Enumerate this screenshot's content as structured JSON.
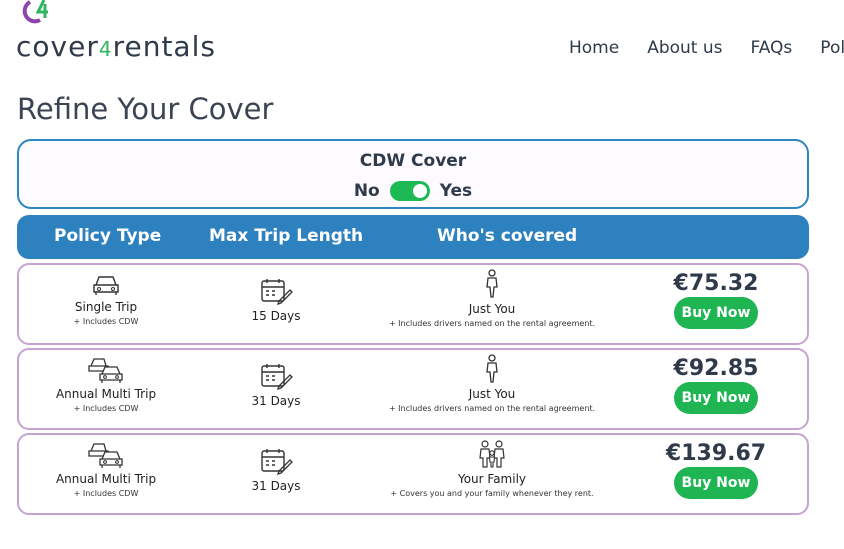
{
  "logo": {
    "part1": "cover",
    "part2": "4",
    "part3": "rentals"
  },
  "nav": [
    {
      "label": "Home"
    },
    {
      "label": "About us"
    },
    {
      "label": "FAQs"
    },
    {
      "label": "Pol"
    }
  ],
  "page_title": "Refine Your Cover",
  "cdw": {
    "title": "CDW Cover",
    "no_label": "No",
    "yes_label": "Yes",
    "enabled": true
  },
  "table_header": {
    "policy_type": "Policy Type",
    "max_trip": "Max Trip Length",
    "who": "Who's covered"
  },
  "rows": [
    {
      "policy": "Single Trip",
      "policy_sub": "+ Includes CDW",
      "trip": "15 Days",
      "who": "Just You",
      "who_sub": "+ Includes drivers named on the rental agreement.",
      "price": "€75.32",
      "buy": "Buy Now"
    },
    {
      "policy": "Annual Multi Trip",
      "policy_sub": "+ Includes CDW",
      "trip": "31 Days",
      "who": "Just You",
      "who_sub": "+ Includes drivers named on the rental agreement.",
      "price": "€92.85",
      "buy": "Buy Now"
    },
    {
      "policy": "Annual Multi Trip",
      "policy_sub": "+ Includes CDW",
      "trip": "31 Days",
      "who": "Your Family",
      "who_sub": "+ Covers you and your family whenever they rent.",
      "price": "€139.67",
      "buy": "Buy Now"
    }
  ],
  "colors": {
    "accent_blue": "#2e81bf",
    "buy_green": "#1fb553",
    "row_border": "#c7a3d1",
    "logo_purple": "#8e44ad"
  }
}
